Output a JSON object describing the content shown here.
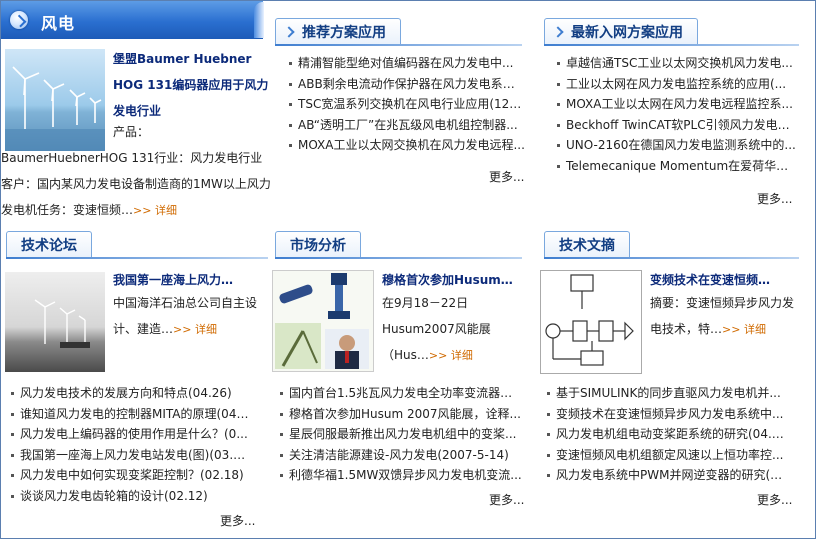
{
  "top": {
    "title": "风电",
    "feature": {
      "title": "堡盟Baumer Huebner HOG 131编码器应用于风力发电行业",
      "body": "产品：BaumerHuebnerHOG 131行业：风力发电行业客户：国内某风力发电设备制造商的1MW以上风力发电机任务：变速恒频…",
      "more": ">> 详细"
    }
  },
  "recommend": {
    "title": "推荐方案应用",
    "items": [
      "精浦智能型绝对值编码器在风力发电中...",
      "ABB剩余电流动作保护器在风力发电系统...",
      "TSC宽温系列交换机在风电行业应用(12.2...",
      "AB“透明工厂”在兆瓦级风电机组控制器...",
      "MOXA工业以太网交换机在风力发电远程..."
    ],
    "more": "更多..."
  },
  "latest": {
    "title": "最新入网方案应用",
    "items": [
      "卓越信通TSC工业以太网交换机风力发电...",
      "工业以太网在风力发电监控系统的应用(...",
      "MOXA工业以太网在风力发电远程监控系...",
      "Beckhoff TwinCAT软PLC引领风力发电技...",
      "UNO-2160在德国风力发电监测系统中的...",
      "Telemecanique Momentum在爱荷华北..."
    ],
    "more": "更多..."
  },
  "tech_forum": {
    "title": "技术论坛",
    "feature": {
      "title": "我国第一座海上风力…",
      "body": "中国海洋石油总公司自主设计、建造…",
      "more": ">> 详细"
    },
    "items": [
      "风力发电技术的发展方向和特点(04.26)",
      "谁知道风力发电的控制器MITA的原理(04....",
      "风力发电上编码器的使用作用是什么？(0...",
      "我国第一座海上风力发电站发电(图)(03.12)",
      "风力发电中如何实现变桨距控制？(02.18)",
      "谈谈风力发电齿轮箱的设计(02.12)"
    ],
    "more": "更多..."
  },
  "market": {
    "title": "市场分析",
    "feature": {
      "title": "穆格首次参加Husum…",
      "body": "在9月18－22日Husum2007风能展（Hus…",
      "more": ">> 详细"
    },
    "items": [
      "国内首台1.5兆瓦风力发电全功率变流器在...",
      "穆格首次参加Husum 2007风能展，诠释...",
      "星辰伺服最新推出风力发电机组中的变桨...",
      "关注清洁能源建设-风力发电(2007-5-14)",
      "利德华福1.5MW双馈异步风力发电机变流..."
    ],
    "more": "更多..."
  },
  "tech_docs": {
    "title": "技术文摘",
    "feature": {
      "title": "变频技术在变速恒频…",
      "body": "摘要：变速恒频异步风力发电技术，特…",
      "more": ">> 详细"
    },
    "items": [
      "基于SIMULINK的同步直驱风力发电机并...",
      "变频技术在变速恒频异步风力发电系统中...",
      "风力发电机组电动变桨距系统的研究(04.1...",
      "变速恒频风电机组额定风速以上恒功率控...",
      "风力发电系统中PWM并网逆变器的研究(0..."
    ],
    "more": "更多..."
  },
  "colors": {
    "accent": "#2a6fd0",
    "title_text": "#0c2a7a",
    "more_link": "#d06a00"
  }
}
